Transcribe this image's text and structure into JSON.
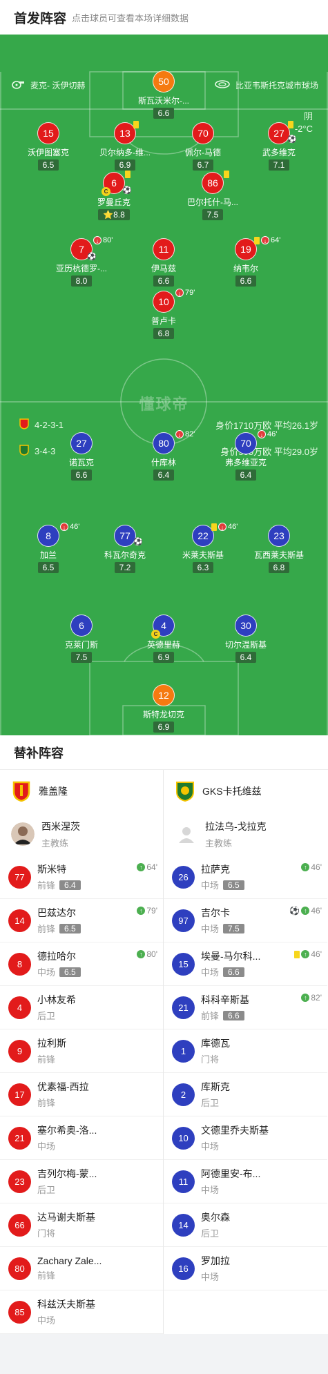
{
  "header": {
    "title": "首发阵容",
    "subtitle": "点击球员可查看本场详细数据"
  },
  "pitch": {
    "referee": "麦克- 沃伊切赫",
    "stadium": "比亚韦斯托克城市球场",
    "weather": "阴",
    "temperature": "-2°C",
    "watermark": "懂球帝",
    "home_formation": "4-2-3-1",
    "home_value": "身价1710万欧 平均26.1岁",
    "away_formation": "3-4-3",
    "away_value": "身价505万欧   平均29.0岁"
  },
  "home_players": [
    {
      "num": "50",
      "name": "斯瓦沃米尔-...",
      "rating": "6.6"
    },
    {
      "num": "15",
      "name": "沃伊图塞克",
      "rating": "6.5"
    },
    {
      "num": "13",
      "name": "贝尔纳多-维...",
      "rating": "6.9"
    },
    {
      "num": "70",
      "name": "佩尔-马德",
      "rating": "6.7"
    },
    {
      "num": "27",
      "name": "武多维克",
      "rating": "7.1"
    },
    {
      "num": "6",
      "name": "罗曼丘克",
      "rating": "8.8"
    },
    {
      "num": "86",
      "name": "巴尔托什-马...",
      "rating": "7.5"
    },
    {
      "num": "7",
      "name": "亚历杭德罗-...",
      "rating": "8.0",
      "event": "80'"
    },
    {
      "num": "11",
      "name": "伊马兹",
      "rating": "6.6"
    },
    {
      "num": "19",
      "name": "纳韦尔",
      "rating": "6.6",
      "event": "64'"
    },
    {
      "num": "10",
      "name": "普卢卡",
      "rating": "6.8",
      "event": "79'"
    }
  ],
  "away_players": [
    {
      "num": "27",
      "name": "诺瓦克",
      "rating": "6.6"
    },
    {
      "num": "80",
      "name": "什库林",
      "rating": "6.4",
      "event": "82'"
    },
    {
      "num": "70",
      "name": "弗多维亚克",
      "rating": "6.4",
      "event": "46'"
    },
    {
      "num": "8",
      "name": "加兰",
      "rating": "6.5",
      "event": "46'"
    },
    {
      "num": "77",
      "name": "科瓦尔奇克",
      "rating": "7.2"
    },
    {
      "num": "22",
      "name": "米莱夫斯基",
      "rating": "6.3",
      "event": "46'"
    },
    {
      "num": "23",
      "name": "瓦西莱夫斯基",
      "rating": "6.8"
    },
    {
      "num": "6",
      "name": "克莱门斯",
      "rating": "7.5"
    },
    {
      "num": "4",
      "name": "英德里赫",
      "rating": "6.9"
    },
    {
      "num": "30",
      "name": "切尔温斯基",
      "rating": "6.4"
    },
    {
      "num": "12",
      "name": "斯特龙切克",
      "rating": "6.9"
    }
  ],
  "subs_title": "替补阵容",
  "home_team": {
    "name": "雅盖隆",
    "coach": "西米涅茨",
    "coach_role": "主教练",
    "primary": "#e21b1b",
    "secondary": "#f5c400"
  },
  "away_team": {
    "name": "GKS卡托维兹",
    "coach": "拉法乌-戈拉克",
    "coach_role": "主教练",
    "primary": "#1f7a2e",
    "secondary": "#f5c400"
  },
  "home_subs": [
    {
      "num": "77",
      "name": "斯米特",
      "pos": "前锋",
      "rating": "6.4",
      "event": "64'"
    },
    {
      "num": "14",
      "name": "巴兹达尔",
      "pos": "前锋",
      "rating": "6.5",
      "event": "79'"
    },
    {
      "num": "8",
      "name": "德拉哈尔",
      "pos": "中场",
      "rating": "6.5",
      "event": "80'"
    },
    {
      "num": "4",
      "name": "小林友希",
      "pos": "后卫"
    },
    {
      "num": "9",
      "name": "拉利斯",
      "pos": "前锋"
    },
    {
      "num": "17",
      "name": "优素福-西拉",
      "pos": "前锋"
    },
    {
      "num": "21",
      "name": "塞尔希奥-洛...",
      "pos": "中场"
    },
    {
      "num": "23",
      "name": "吉列尔梅-蒙...",
      "pos": "后卫"
    },
    {
      "num": "66",
      "name": "达马谢夫斯基",
      "pos": "门将"
    },
    {
      "num": "80",
      "name": "Zachary Zale...",
      "pos": "前锋"
    },
    {
      "num": "85",
      "name": "科兹沃夫斯基",
      "pos": "中场"
    }
  ],
  "away_subs": [
    {
      "num": "26",
      "name": "拉萨克",
      "pos": "中场",
      "rating": "6.5",
      "event": "46'"
    },
    {
      "num": "97",
      "name": "吉尔卡",
      "pos": "中场",
      "rating": "7.5",
      "event": "46'"
    },
    {
      "num": "15",
      "name": "埃曼-马尔科...",
      "pos": "中场",
      "rating": "6.6",
      "event": "46'"
    },
    {
      "num": "21",
      "name": "科科辛斯基",
      "pos": "前锋",
      "rating": "6.6",
      "event": "82'"
    },
    {
      "num": "1",
      "name": "库德瓦",
      "pos": "门将"
    },
    {
      "num": "2",
      "name": "库斯克",
      "pos": "后卫"
    },
    {
      "num": "10",
      "name": "文德里乔夫斯基",
      "pos": "中场"
    },
    {
      "num": "11",
      "name": "阿德里安-布...",
      "pos": "中场"
    },
    {
      "num": "14",
      "name": "奥尔森",
      "pos": "后卫"
    },
    {
      "num": "16",
      "name": "罗加拉",
      "pos": "中场"
    }
  ],
  "icons": {
    "whistle": "whistle-icon",
    "stadium": "stadium-icon",
    "sub_out": "sub-out-icon",
    "sub_in": "sub-in-icon",
    "yellow_card": "yellow-card-icon",
    "goal": "ball-icon",
    "captain": "captain-icon"
  }
}
